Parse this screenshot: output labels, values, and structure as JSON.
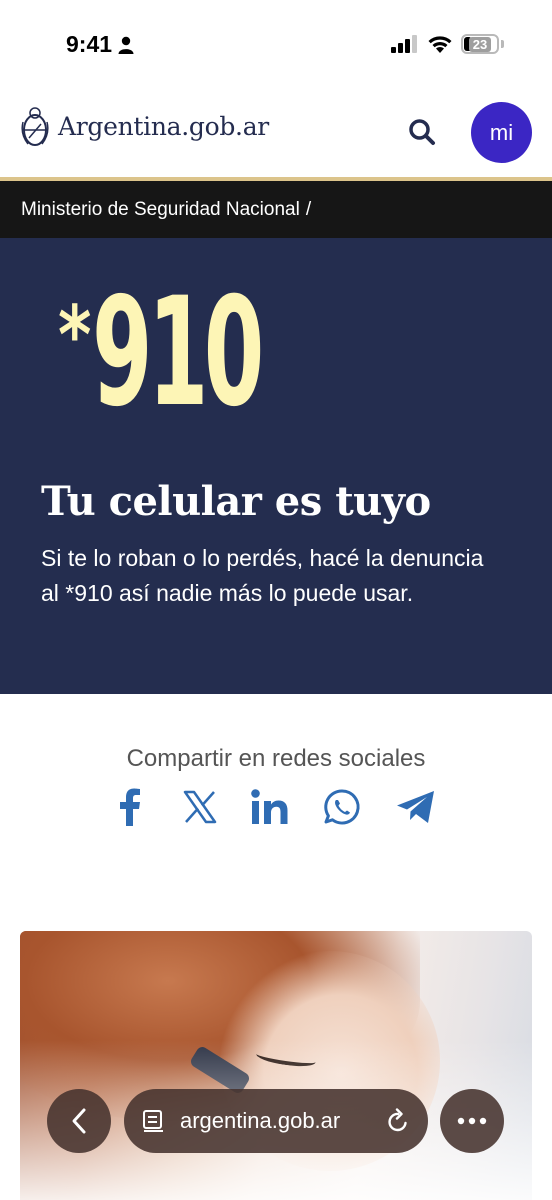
{
  "status": {
    "time": "9:41",
    "battery_level": "23",
    "icons": [
      "person-icon",
      "signal-icon",
      "wifi-icon",
      "battery-icon"
    ]
  },
  "header": {
    "logo_text": "Argentina.gob.ar",
    "logo_icon": "coat-of-arms-icon",
    "search_icon": "search-icon",
    "mi_label": "mi",
    "colors": {
      "logo_text": "#242c4f",
      "mi_button": "#3b26c4",
      "accent_line": "#dcc48b"
    }
  },
  "breadcrumb": {
    "items": [
      "Ministerio de Seguridad Nacional"
    ],
    "separator": "/"
  },
  "hero": {
    "number_prefix": "*",
    "number": "910",
    "title": "Tu celular es tuyo",
    "description": "Si te lo roban o lo perdés, hacé la denuncia al *910 así nadie más lo puede usar.",
    "colors": {
      "background": "#242d4f",
      "number": "#fdf5b6"
    }
  },
  "share": {
    "title": "Compartir en redes sociales",
    "icons": [
      "facebook-icon",
      "x-icon",
      "linkedin-icon",
      "whatsapp-icon",
      "telegram-icon"
    ],
    "color": "#2f6cb3"
  },
  "browser": {
    "url": "argentina.gob.ar",
    "icons": [
      "back-icon",
      "tabs-icon",
      "reload-icon",
      "more-icon"
    ]
  }
}
